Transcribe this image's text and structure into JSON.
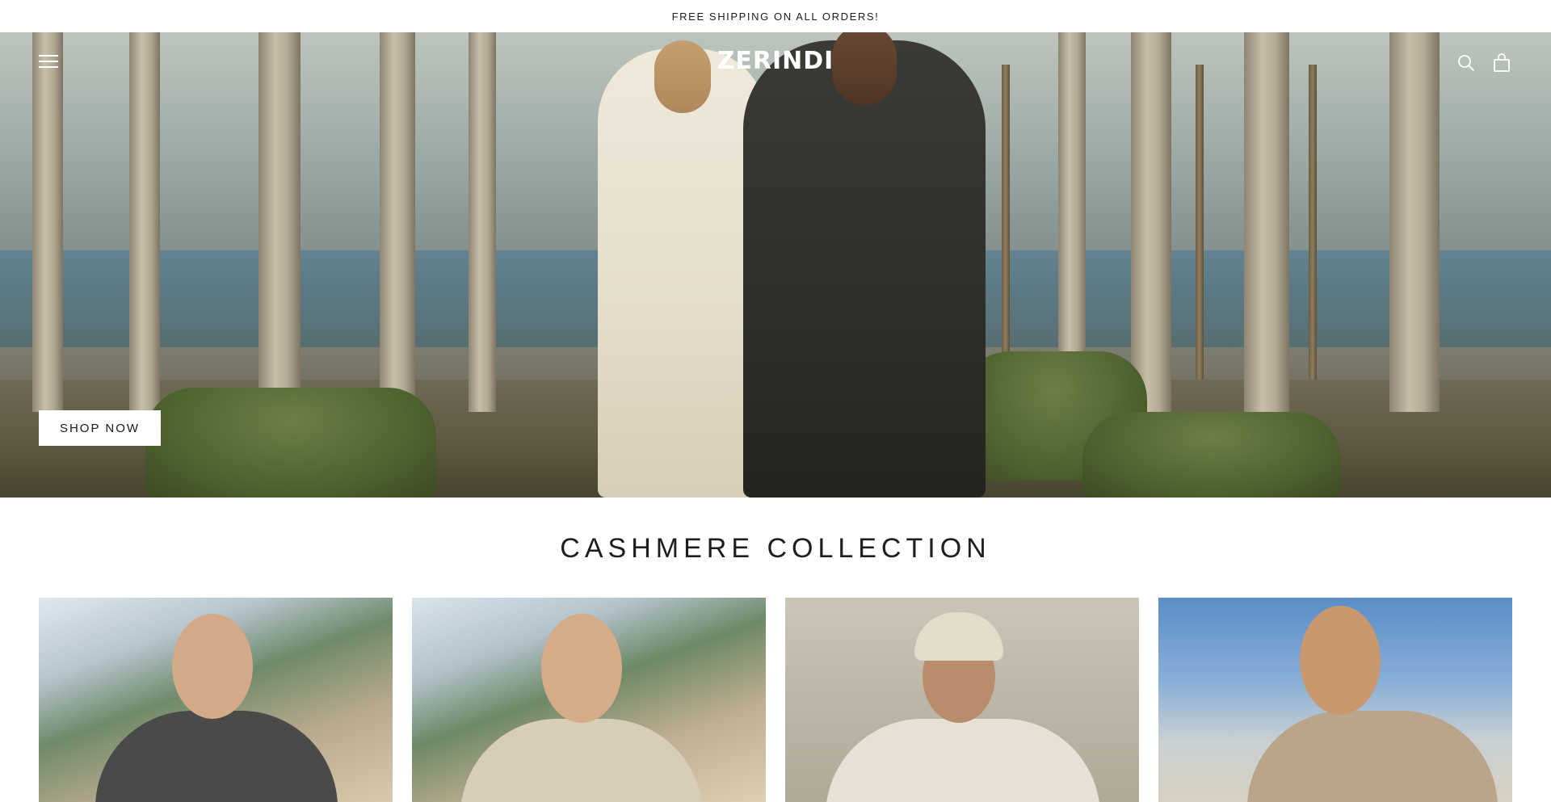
{
  "announcement": {
    "text": "FREE SHIPPING ON ALL ORDERS!"
  },
  "header": {
    "logo": "ZERINDI",
    "icons": {
      "menu": "menu-icon",
      "search": "search-icon",
      "cart": "bag-icon"
    }
  },
  "hero": {
    "cta_label": "SHOP NOW"
  },
  "collection": {
    "title": "CASHMERE COLLECTION",
    "products": [
      {
        "image": "grey polo knit, coastal village"
      },
      {
        "image": "cream ribbed quarter-zip, coastal village"
      },
      {
        "image": "cream zip knit with cap"
      },
      {
        "image": "beige knit shirt, city skyline"
      }
    ]
  },
  "colors": {
    "accent": "#ffffff",
    "text": "#1a1a1a"
  }
}
